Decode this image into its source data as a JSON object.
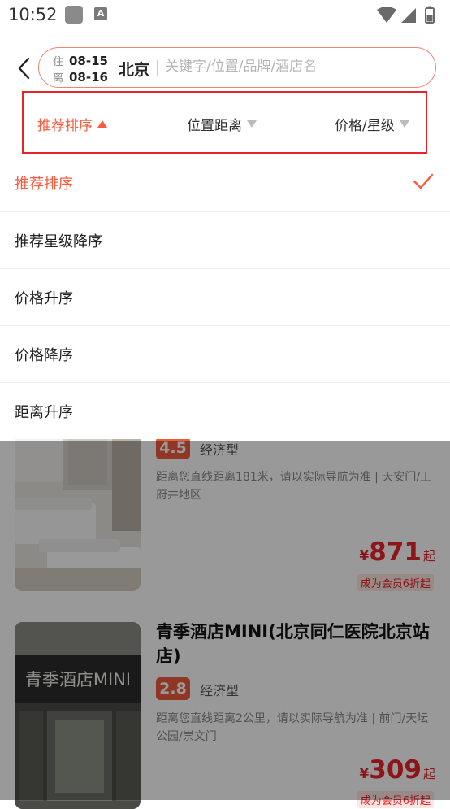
{
  "status_bar": {
    "time": "10:52",
    "a_icon_text": "A"
  },
  "header": {
    "checkin_label": "住",
    "checkin_date": "08-15",
    "checkout_label": "离",
    "checkout_date": "08-16",
    "city": "北京",
    "search_placeholder": "关键字/位置/品牌/酒店名"
  },
  "sort_tabs": [
    {
      "label": "推荐排序",
      "active": true
    },
    {
      "label": "位置距离",
      "active": false
    },
    {
      "label": "价格/星级",
      "active": false
    }
  ],
  "sort_options": [
    {
      "label": "推荐排序",
      "selected": true
    },
    {
      "label": "推荐星级降序",
      "selected": false
    },
    {
      "label": "价格升序",
      "selected": false
    },
    {
      "label": "价格降序",
      "selected": false
    },
    {
      "label": "距离升序",
      "selected": false
    }
  ],
  "hotels": [
    {
      "score": "4.5",
      "type": "经济型",
      "desc": "距离您直线距离181米，请以实际导航为准 | 天安门/王府井地区",
      "price_currency": "¥",
      "price": "871",
      "price_suffix": "起",
      "member_tag": "成为会员6折起"
    },
    {
      "name": "青季酒店MINI(北京同仁医院北京站店)",
      "score": "2.8",
      "type": "经济型",
      "desc": "距离您直线距离2公里，请以实际导航为准 | 前门/天坛公园/崇文门",
      "price_currency": "¥",
      "price": "309",
      "price_suffix": "起",
      "member_tag": "成为会员6折起",
      "sign_text": "青季酒店MINI"
    }
  ],
  "colors": {
    "accent": "#fb5a3c",
    "highlight_border": "#e8232a",
    "price": "#e8232a"
  }
}
